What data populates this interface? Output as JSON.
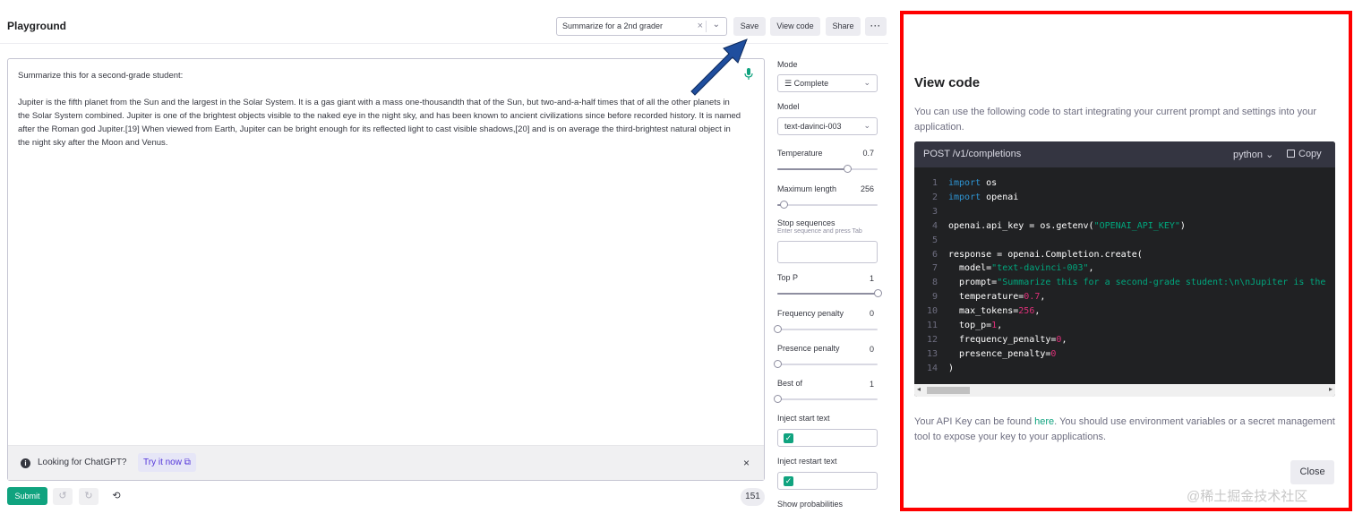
{
  "header": {
    "title": "Playground",
    "preset": "Summarize for a 2nd grader",
    "save_label": "Save",
    "view_code_label": "View code",
    "share_label": "Share",
    "more_label": "···"
  },
  "editor": {
    "prompt_line1": "Summarize this for a second-grade student:",
    "prompt_body": "Jupiter is the fifth planet from the Sun and the largest in the Solar System. It is a gas giant with a mass one-thousandth that of the Sun, but two-and-a-half times that of all the other planets in the Solar System combined. Jupiter is one of the brightest objects visible to the naked eye in the night sky, and has been known to ancient civilizations since before recorded history. It is named after the Roman god Jupiter.[19] When viewed from Earth, Jupiter can be bright enough for its reflected light to cast visible shadows,[20] and is on average the third-brightest natural object in the night sky after the Moon and Venus.",
    "banner_text": "Looking for ChatGPT?",
    "banner_link": "Try it now",
    "token_count": "151",
    "submit_label": "Submit"
  },
  "settings": {
    "mode_label": "Mode",
    "mode_value": "Complete",
    "model_label": "Model",
    "model_value": "text-davinci-003",
    "temperature_label": "Temperature",
    "temperature_value": "0.7",
    "temperature_fraction": 0.7,
    "max_length_label": "Maximum length",
    "max_length_value": "256",
    "max_length_fraction": 0.06,
    "stop_label": "Stop sequences",
    "stop_hint": "Enter sequence and press Tab",
    "top_p_label": "Top P",
    "top_p_value": "1",
    "top_p_fraction": 1.0,
    "freq_label": "Frequency penalty",
    "freq_value": "0",
    "freq_fraction": 0.0,
    "presence_label": "Presence penalty",
    "presence_value": "0",
    "presence_fraction": 0.0,
    "best_of_label": "Best of",
    "best_of_value": "1",
    "best_of_fraction": 0.0,
    "inject_start_label": "Inject start text",
    "inject_restart_label": "Inject restart text",
    "show_prob_label": "Show probabilities"
  },
  "view_code": {
    "title": "View code",
    "description": "You can use the following code to start integrating your current prompt and settings into your application.",
    "endpoint": "POST /v1/completions",
    "language": "python",
    "copy_label": "Copy",
    "code": {
      "l1_kw": "import",
      "l1_rest": " os",
      "l2_kw": "import",
      "l2_rest": " openai",
      "l4_pre": "openai.api_key = os.getenv(",
      "l4_str": "\"OPENAI_API_KEY\"",
      "l4_post": ")",
      "l6": "response = openai.Completion.create(",
      "l7_pre": "  model=",
      "l7_str": "\"text-davinci-003\"",
      "l7_post": ",",
      "l8_pre": "  prompt=",
      "l8_str": "\"Summarize this for a second-grade student:\\n\\nJupiter is the",
      "l9_pre": "  temperature=",
      "l9_num": "0.7",
      "l9_post": ",",
      "l10_pre": "  max_tokens=",
      "l10_num": "256",
      "l10_post": ",",
      "l11_pre": "  top_p=",
      "l11_num": "1",
      "l11_post": ",",
      "l12_pre": "  frequency_penalty=",
      "l12_num": "0",
      "l12_post": ",",
      "l13_pre": "  presence_penalty=",
      "l13_num": "0",
      "l14": ")"
    },
    "api_key_pre": "Your API Key can be found ",
    "api_key_link": "here",
    "api_key_post": ". You should use environment variables or a secret management tool to expose your key to your applications.",
    "close_label": "Close"
  },
  "watermark": "@稀土掘金技术社区",
  "colors": {
    "accent": "#10a37f",
    "highlight_border": "#ff0000",
    "arrow": "#1f4e9e",
    "link": "#5436da"
  }
}
